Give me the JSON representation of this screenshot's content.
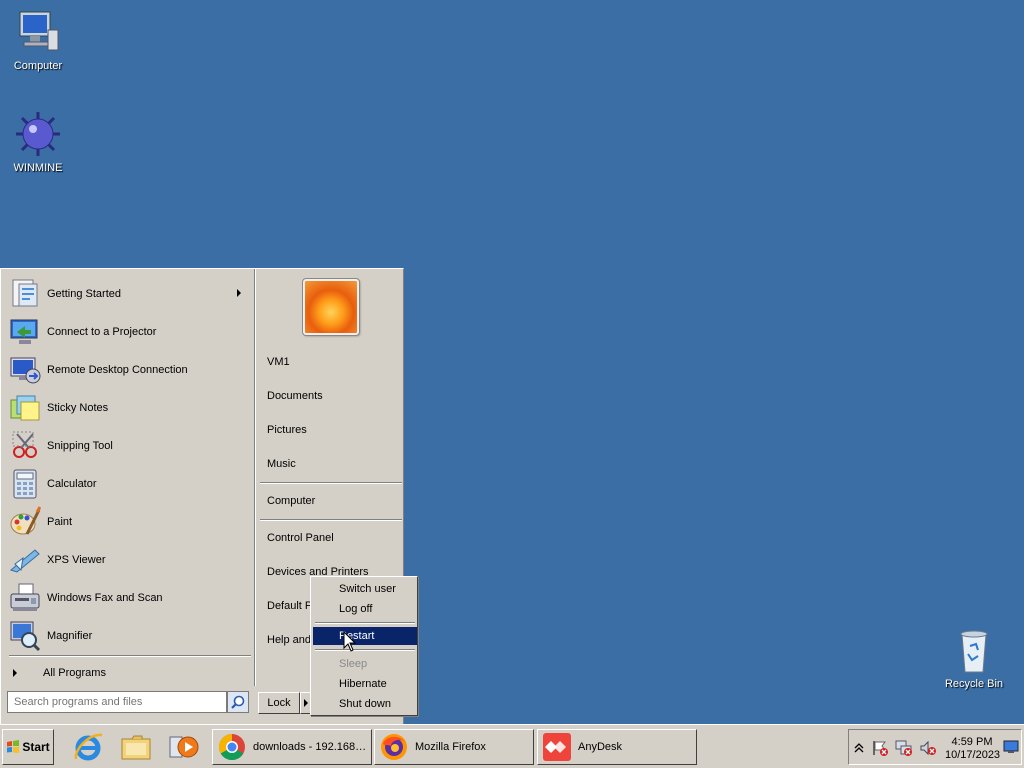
{
  "desktop": {
    "icons": [
      {
        "label": "Computer",
        "icon": "computer-icon"
      },
      {
        "label": "WINMINE",
        "icon": "mine-icon"
      },
      {
        "label": "Recycle Bin",
        "icon": "recycle-bin-icon"
      }
    ]
  },
  "start_menu": {
    "programs": [
      {
        "label": "Getting Started",
        "icon": "getting-started-icon",
        "has_submenu": true
      },
      {
        "label": "Connect to a Projector",
        "icon": "projector-icon"
      },
      {
        "label": "Remote Desktop Connection",
        "icon": "remote-desktop-icon"
      },
      {
        "label": "Sticky Notes",
        "icon": "sticky-notes-icon"
      },
      {
        "label": "Snipping Tool",
        "icon": "snipping-tool-icon"
      },
      {
        "label": "Calculator",
        "icon": "calculator-icon"
      },
      {
        "label": "Paint",
        "icon": "paint-icon"
      },
      {
        "label": "XPS Viewer",
        "icon": "xps-viewer-icon"
      },
      {
        "label": "Windows Fax and Scan",
        "icon": "fax-scan-icon"
      },
      {
        "label": "Magnifier",
        "icon": "magnifier-icon"
      }
    ],
    "all_programs": "All Programs",
    "search_placeholder": "Search programs and files",
    "right_items": {
      "user": "VM1",
      "documents": "Documents",
      "pictures": "Pictures",
      "music": "Music",
      "computer": "Computer",
      "control_panel": "Control Panel",
      "devices": "Devices and Printers",
      "default": "Default P",
      "help": "Help and"
    },
    "lock_label": "Lock"
  },
  "power_menu": {
    "items": [
      {
        "label": "Switch user",
        "state": "normal"
      },
      {
        "label": "Log off",
        "state": "normal"
      },
      {
        "label": "Restart",
        "state": "highlighted"
      },
      {
        "label": "Sleep",
        "state": "disabled"
      },
      {
        "label": "Hibernate",
        "state": "normal"
      },
      {
        "label": "Shut down",
        "state": "normal"
      }
    ]
  },
  "taskbar": {
    "start_label": "Start",
    "quick_launch": [
      "internet-explorer-icon",
      "explorer-icon",
      "media-player-icon"
    ],
    "tasks": [
      {
        "label": "downloads - 192.168…",
        "icon": "chrome-icon"
      },
      {
        "label": "Mozilla Firefox",
        "icon": "firefox-icon"
      },
      {
        "label": "AnyDesk",
        "icon": "anydesk-icon"
      }
    ],
    "clock": {
      "time": "4:59 PM",
      "date": "10/17/2023"
    }
  },
  "colors": {
    "desktop": "#3a6ea5",
    "chrome": "#d4d0c8",
    "highlight": "#0a246a"
  }
}
